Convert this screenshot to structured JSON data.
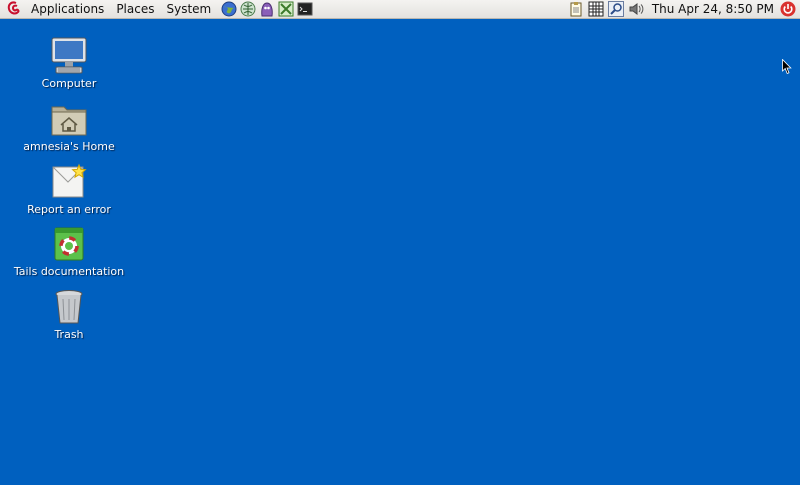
{
  "panel": {
    "menus": [
      "Applications",
      "Places",
      "System"
    ],
    "launchers": [
      "web-browser-icon",
      "network-icon",
      "pidgin-icon",
      "vidalia-icon",
      "terminal-icon"
    ],
    "tray": [
      "clipboard-icon",
      "keyboard-icon",
      "search-icon",
      "volume-icon"
    ],
    "clock": "Thu Apr 24,  8:50 PM"
  },
  "desktop": {
    "icons": [
      {
        "label": "Computer",
        "icon": "computer-icon"
      },
      {
        "label": "amnesia's Home",
        "icon": "home-folder-icon"
      },
      {
        "label": "Report an error",
        "icon": "report-error-icon"
      },
      {
        "label": "Tails documentation",
        "icon": "documentation-icon"
      },
      {
        "label": "Trash",
        "icon": "trash-icon"
      }
    ]
  },
  "colors": {
    "desktop_background": "#0060bf",
    "panel_background": "#ebe9e6"
  }
}
